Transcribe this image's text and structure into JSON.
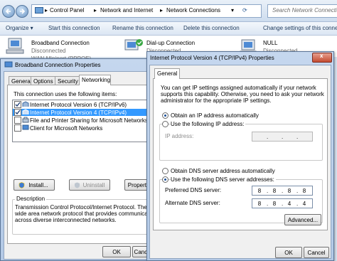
{
  "explorer": {
    "breadcrumb": [
      "Control Panel",
      "Network and Internet",
      "Network Connections"
    ],
    "search_placeholder": "Search Network Connections",
    "toolbar": [
      "Organize ▾",
      "Start this connection",
      "Rename this connection",
      "Delete this connection",
      "Change settings of this connection"
    ],
    "connections": [
      {
        "name": "Broadband Connection",
        "status": "Disconnected",
        "device": "WAN Miniport (PPPOE)"
      },
      {
        "name": "Dial-up Connection",
        "status": "Disconnected"
      },
      {
        "name": "NULL",
        "status": "Disconnected"
      }
    ]
  },
  "props": {
    "title": "Broadband Connection Properties",
    "tabs": [
      "General",
      "Options",
      "Security",
      "Networking"
    ],
    "uses_label": "This connection uses the following items:",
    "items": [
      {
        "label": "Internet Protocol Version 6 (TCP/IPv6)",
        "checked": true
      },
      {
        "label": "Internet Protocol Version 4 (TCP/IPv4)",
        "checked": true
      },
      {
        "label": "File and Printer Sharing for Microsoft Networks",
        "checked": false
      },
      {
        "label": "Client for Microsoft Networks",
        "checked": false
      }
    ],
    "install": "Install...",
    "uninstall": "Uninstall",
    "properties": "Properties",
    "description_heading": "Description",
    "description_lines": [
      "Transmission Control Protocol/Internet Protocol. The defau",
      "wide area network protocol that provides communication",
      "across diverse interconnected networks."
    ],
    "ok": "OK",
    "cancel": "Cancel"
  },
  "ipv4": {
    "title": "Internet Protocol Version 4 (TCP/IPv4) Properties",
    "tab": "General",
    "intro_lines": [
      "You can get IP settings assigned automatically if your network",
      "supports this capability. Otherwise, you need to ask your network",
      "administrator for the appropriate IP settings."
    ],
    "obtain_ip": "Obtain an IP address automatically",
    "use_ip": "Use the following IP address:",
    "ip_label": "IP address:",
    "obtain_dns": "Obtain DNS server address automatically",
    "use_dns": "Use the following DNS server addresses:",
    "preferred_label": "Preferred DNS server:",
    "preferred": [
      "8",
      "8",
      "8",
      "8"
    ],
    "alternate_label": "Alternate DNS server:",
    "alternate": [
      "8",
      "8",
      "4",
      "4"
    ],
    "advanced": "Advanced...",
    "ok": "OK",
    "cancel": "Cancel"
  }
}
